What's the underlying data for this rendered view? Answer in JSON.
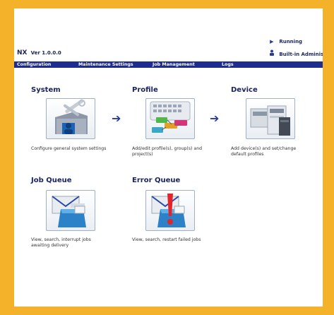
{
  "status": {
    "running_label": "Running",
    "user_label": "Built-in Administr"
  },
  "app": {
    "name": "NX",
    "version": "Ver 1.0.0.0"
  },
  "nav": {
    "items": [
      "Configuration",
      "Maintenance Settings",
      "Job Management",
      "Logs"
    ]
  },
  "tiles": {
    "system": {
      "title": "System",
      "desc": "Configure general system settings",
      "icon": "system-settings-icon"
    },
    "profile": {
      "title": "Profile",
      "desc": "Add/edit profile(s), group(s) and project(s)",
      "icon": "profile-icon"
    },
    "device": {
      "title": "Device",
      "desc": "Add device(s) and set/change default profiles",
      "icon": "device-icon"
    },
    "job_queue": {
      "title": "Job Queue",
      "desc": "View, search, interrupt jobs awaiting delivery",
      "icon": "job-queue-icon"
    },
    "error_queue": {
      "title": "Error Queue",
      "desc": "View, search, restart failed jobs",
      "icon": "error-queue-icon"
    }
  },
  "colors": {
    "border": "#f3b22a",
    "navbar": "#1e2c8f",
    "title": "#1b2360"
  }
}
